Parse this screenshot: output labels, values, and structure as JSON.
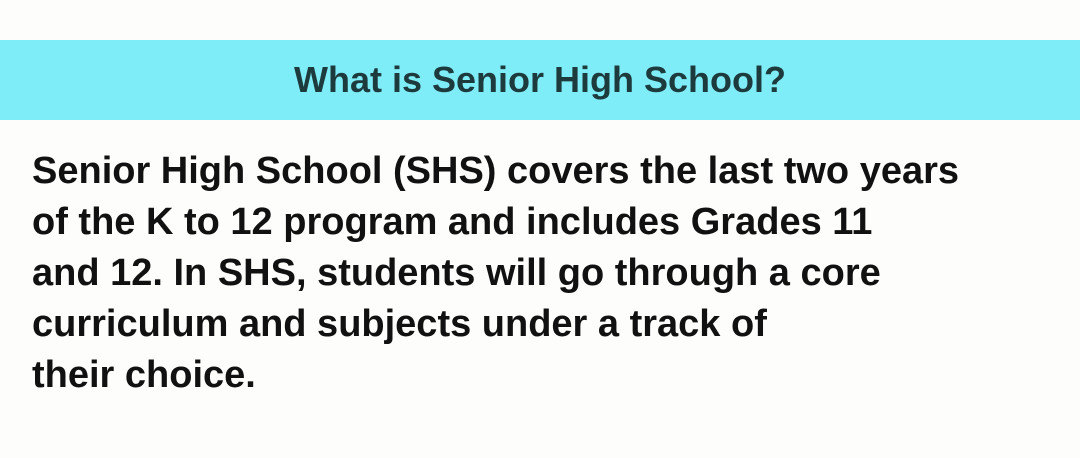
{
  "header": {
    "title": "What is Senior High School?"
  },
  "content": {
    "lines": [
      "Senior High School (SHS) covers the last two years",
      "of the K to 12 program and includes Grades 11",
      "and 12. In SHS, students will go through a core",
      "curriculum and subjects under a track of",
      "their choice."
    ]
  },
  "colors": {
    "header_background": "#7fedf8",
    "header_text": "#1d3a3d",
    "body_text": "#111111",
    "page_background": "#fdfefb"
  }
}
